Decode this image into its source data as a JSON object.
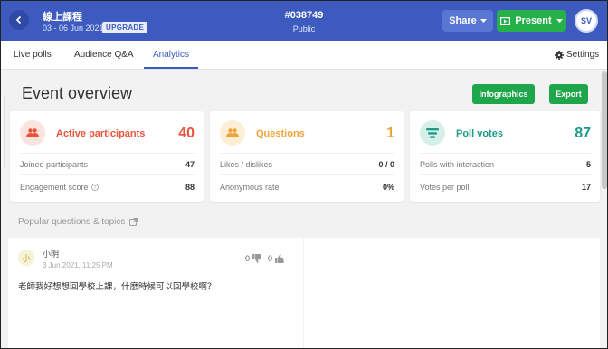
{
  "header": {
    "event_title": "線上課程",
    "dates": "03 - 06 Jun 2021",
    "upgrade_label": "UPGRADE",
    "event_code": "#038749",
    "visibility": "Public",
    "share_label": "Share",
    "present_label": "Present",
    "avatar_initials": "SV"
  },
  "tabs": [
    {
      "label": "Live polls",
      "active": false
    },
    {
      "label": "Audience Q&A",
      "active": false
    },
    {
      "label": "Analytics",
      "active": true
    }
  ],
  "settings_label": "Settings",
  "overview": {
    "title": "Event overview",
    "infographics_label": "Infographics",
    "export_label": "Export"
  },
  "cards": [
    {
      "label": "Active participants",
      "value": "40",
      "color": "#e8533b",
      "icon": "people-icon",
      "rows": [
        {
          "label": "Joined participants",
          "value": "47"
        },
        {
          "label": "Engagement score",
          "value": "88"
        }
      ]
    },
    {
      "label": "Questions",
      "value": "1",
      "color": "#f0a33a",
      "icon": "people-icon",
      "rows": [
        {
          "label": "Likes / dislikes",
          "value": "0 / 0"
        },
        {
          "label": "Anonymous rate",
          "value": "0%"
        }
      ]
    },
    {
      "label": "Poll votes",
      "value": "87",
      "color": "#1d9a87",
      "icon": "poll-icon",
      "rows": [
        {
          "label": "Polls with interaction",
          "value": "5"
        },
        {
          "label": "Votes per poll",
          "value": "17"
        }
      ]
    }
  ],
  "popular": {
    "title": "Popular questions & topics"
  },
  "question": {
    "avatar_char": "小",
    "author": "小明",
    "time": "3 Jun 2021, 11:25 PM",
    "dislikes": "0",
    "likes": "0",
    "text": "老師我好想想回學校上課，什麼時候可以回學校啊？"
  },
  "colors": {
    "header_bg": "#3d5bbf",
    "present_green": "#26b04a",
    "accent_blue": "#3d5bbf"
  }
}
